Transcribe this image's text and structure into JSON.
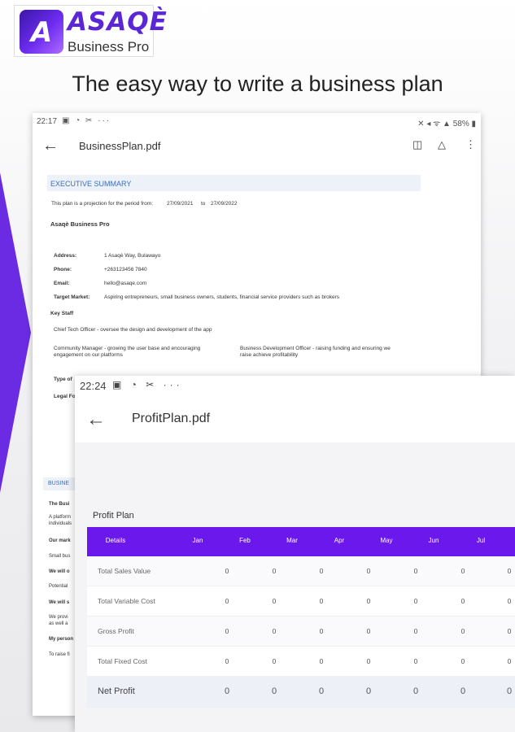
{
  "brand": {
    "name": "ASAQÈ",
    "sub": "Business Pro",
    "mark": "A"
  },
  "headline": "The easy way to write a business plan",
  "phone1": {
    "status": {
      "time": "22:17",
      "icons": "▣ ◔ ✂ ···",
      "right": "✕ ◂ ᯤ ▲ 58% ▮"
    },
    "title": "BusinessPlan.pdf",
    "doc": {
      "section": "EXECUTIVE SUMMARY",
      "period_text": "This plan is a projection for the period from:",
      "period_from": "27/09/2021",
      "period_to_word": "to",
      "period_to": "27/09/2022",
      "company": "Asaqè Business Pro",
      "address_label": "Address:",
      "address": "1 Asaqè Way, Bulawayo",
      "phone_label": "Phone:",
      "phone": "+263123456 7840",
      "email_label": "Email:",
      "email": "hello@asaqe.com",
      "market_label": "Target Market:",
      "market": "Aspiring entrepreneurs, small business owners, students, financial service providers such as brokers",
      "keystaff": "Key Staff",
      "staff1": "Chief Tech Officer - oversee the design and development of the app",
      "staff2a": "Community Manager - growing the user base and encouraging",
      "staff2b": "engagement on our platforms",
      "staff3a": "Business Development Officer - raising funding and ensuring we",
      "staff3b": "raise achieve profitability",
      "typeof": "Type of",
      "legal": "Legal Fo"
    },
    "doc2": {
      "section": "BUSINE",
      "l1": "The Busi",
      "l2": "A platform",
      "l3": "individuals",
      "l4": "Our mark",
      "l5": "Small bus",
      "l6": "We will o",
      "l7": "Potential",
      "l8": "We will s",
      "l9": "We provi",
      "l10": "as well a",
      "l11": "My person",
      "l12": "To raise fi"
    }
  },
  "phone2": {
    "status": {
      "time": "22:24",
      "icons": "▣ ◔ ✂ ···"
    },
    "title": "ProfitPlan.pdf",
    "label": "Profit Plan",
    "columns": [
      "Details",
      "Jan",
      "Feb",
      "Mar",
      "Apr",
      "May",
      "Jun",
      "Jul"
    ],
    "rows": [
      {
        "label": "Total Sales Value",
        "values": [
          "0",
          "0",
          "0",
          "0",
          "0",
          "0",
          "0"
        ]
      },
      {
        "label": "Total Variable Cost",
        "values": [
          "0",
          "0",
          "0",
          "0",
          "0",
          "0",
          "0"
        ]
      },
      {
        "label": "Gross Profit",
        "values": [
          "0",
          "0",
          "0",
          "0",
          "0",
          "0",
          "0"
        ]
      },
      {
        "label": "Total Fixed Cost",
        "values": [
          "0",
          "0",
          "0",
          "0",
          "0",
          "0",
          "0"
        ]
      }
    ],
    "net": {
      "label": "Net Profit",
      "values": [
        "0",
        "0",
        "0",
        "0",
        "0",
        "0",
        "0"
      ]
    }
  }
}
